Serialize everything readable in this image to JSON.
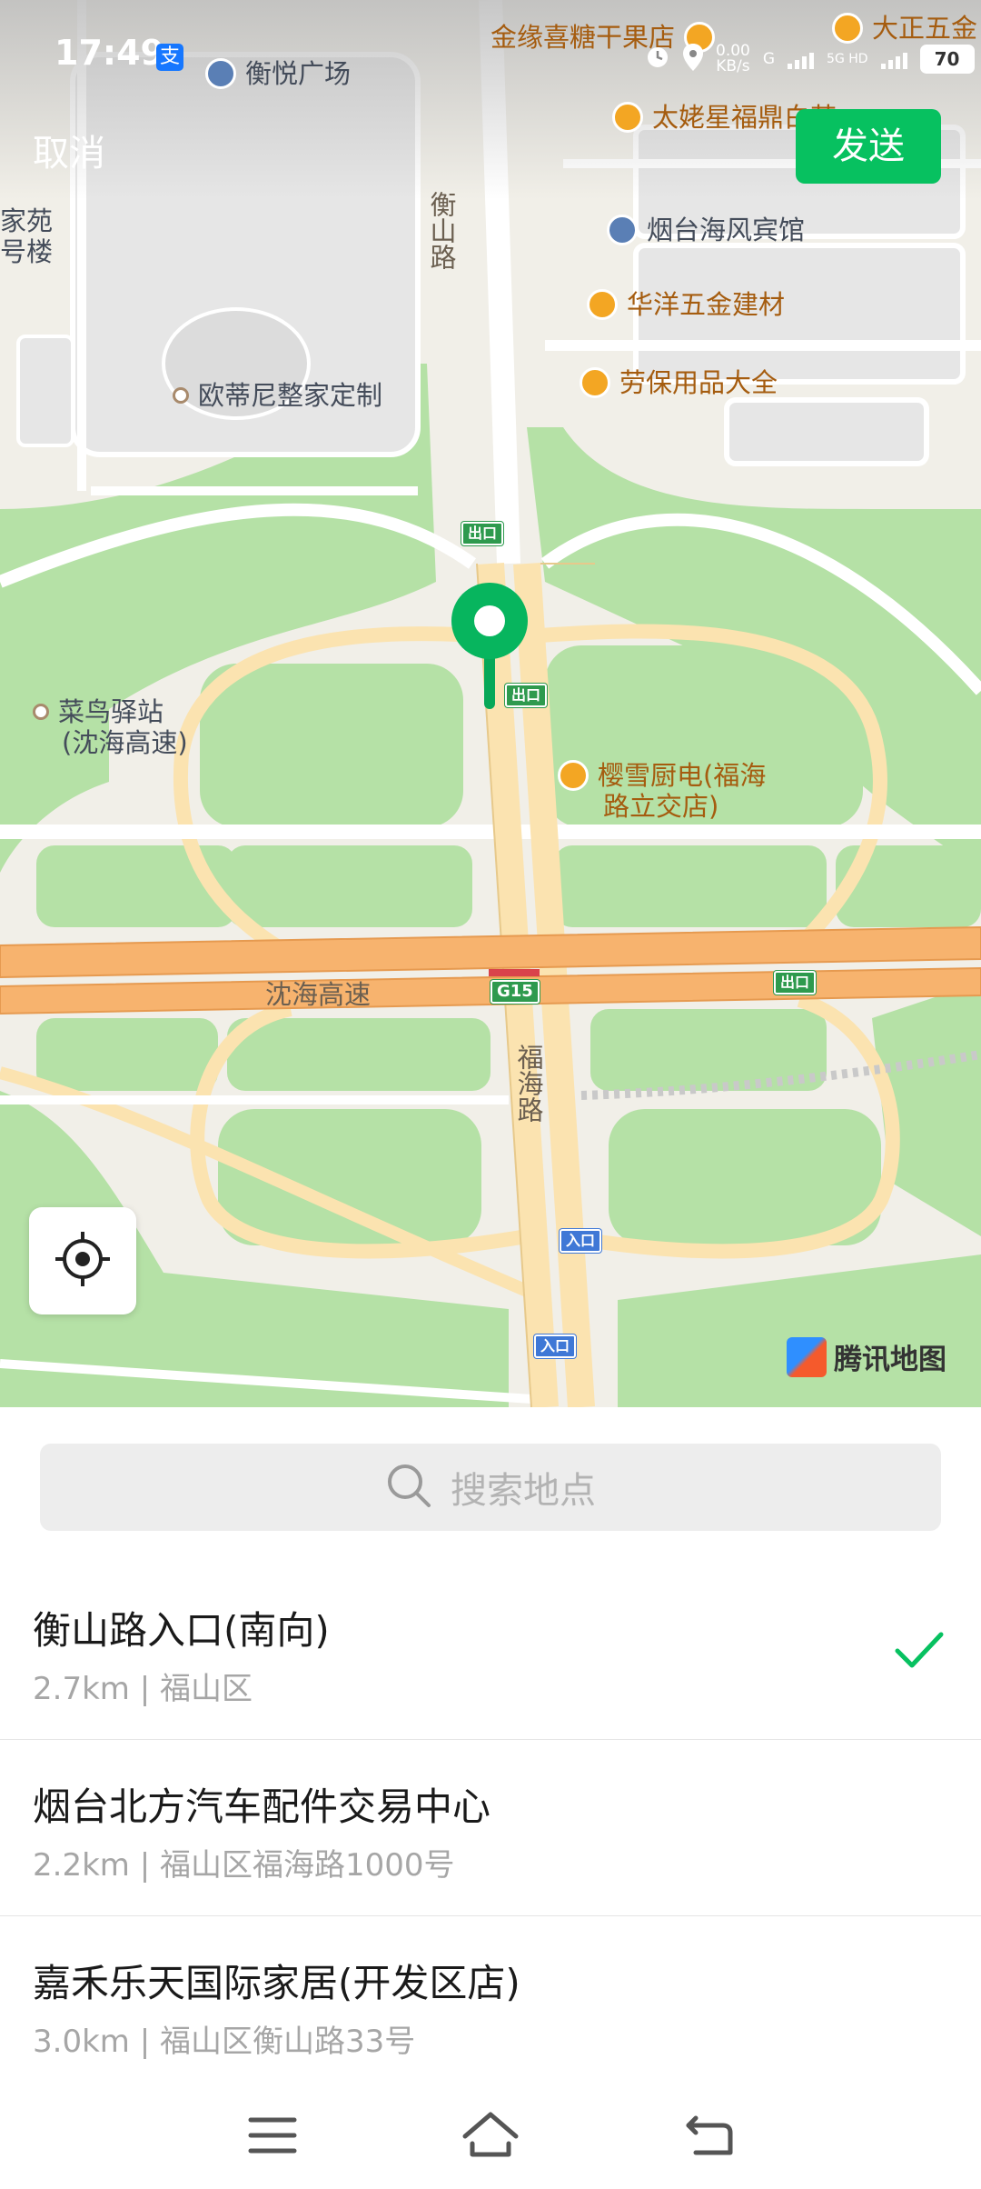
{
  "status_bar": {
    "time": "17:49",
    "pay_badge": "支",
    "net_speed_value": "0.00",
    "net_speed_unit": "KB/s",
    "net_type_1": "G",
    "net_type_2": "5G HD",
    "battery": "70"
  },
  "header": {
    "cancel_label": "取消",
    "send_label": "发送"
  },
  "map": {
    "pois": [
      {
        "name": "金缘喜糖干果店"
      },
      {
        "name": "大正五金"
      },
      {
        "name": "衡悦广场"
      },
      {
        "name": "太姥星福鼎白茶"
      },
      {
        "name": "烟台海风宾馆"
      },
      {
        "name": "华洋五金建材"
      },
      {
        "name": "劳保用品大全"
      },
      {
        "name": "欧蒂尼整家定制"
      },
      {
        "name": "家苑"
      },
      {
        "name": "号楼"
      },
      {
        "name": "菜鸟驿站"
      },
      {
        "name": "(沈海高速)"
      },
      {
        "name": "樱雪厨电(福海"
      },
      {
        "name": "路立交店)"
      }
    ],
    "road_labels": {
      "hengshan": "衡山路",
      "shenhai": "沈海高速",
      "fuhai": "福海路"
    },
    "signs": {
      "exit": "出口",
      "entry": "入口",
      "g15": "G15"
    },
    "logo_text": "腾讯地图"
  },
  "search": {
    "placeholder": "搜索地点"
  },
  "results": [
    {
      "name": "衡山路入口(南向)",
      "detail": "2.7km | 福山区",
      "selected": true
    },
    {
      "name": "烟台北方汽车配件交易中心",
      "detail": "2.2km | 福山区福海路1000号",
      "selected": false
    },
    {
      "name": "嘉禾乐天国际家居(开发区店)",
      "detail": "3.0km | 福山区衡山路33号",
      "selected": false
    }
  ],
  "colors": {
    "accent": "#07c160",
    "check": "#07c160"
  },
  "nav_icons": [
    "menu-icon",
    "home-icon",
    "back-icon"
  ]
}
